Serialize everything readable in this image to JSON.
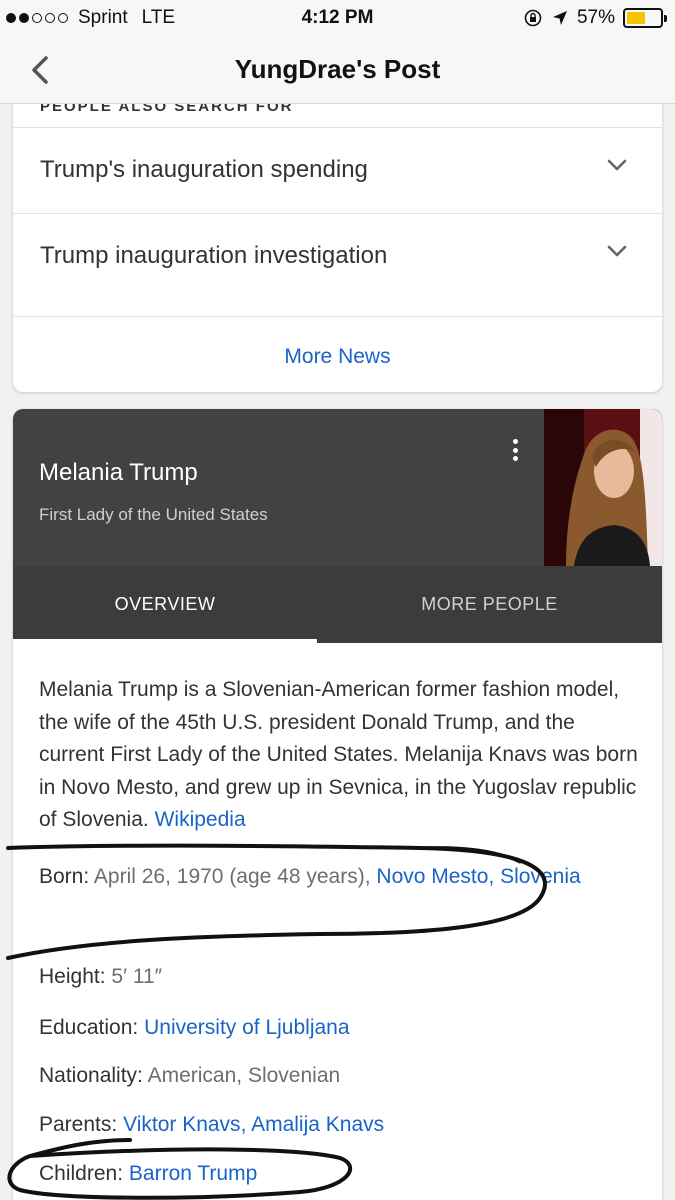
{
  "status_bar": {
    "carrier": "Sprint",
    "network": "LTE",
    "time": "4:12 PM",
    "battery_percent": "57%",
    "battery_level": 0.57,
    "signal_bars_filled": 2,
    "signal_bars_total": 5,
    "colors": {
      "battery": "#f6c400"
    }
  },
  "nav": {
    "title": "YungDrae's Post"
  },
  "people_also_search": {
    "header": "PEOPLE ALSO SEARCH FOR",
    "items": [
      {
        "label": "Trump's inauguration spending"
      },
      {
        "label": "Trump inauguration investigation"
      }
    ],
    "more_news": "More News"
  },
  "knowledge_panel": {
    "name": "Melania Trump",
    "subtitle": "First Lady of the United States",
    "tabs": [
      {
        "label": "OVERVIEW",
        "active": true
      },
      {
        "label": "MORE PEOPLE",
        "active": false
      }
    ],
    "description": "Melania Trump is a Slovenian-American former fashion model, the wife of the 45th U.S. president Donald Trump, and the current First Lady of the United States. Melanija Knavs was born in Novo Mesto, and grew up in Sevnica, in the Yugoslav republic of Slovenia.",
    "source_link": "Wikipedia",
    "facts": {
      "born": {
        "label": "Born:",
        "value": "April 26, 1970 (age 48 years),",
        "link": "Novo Mesto, Slovenia"
      },
      "height": {
        "label": "Height:",
        "value": "5′ 11″"
      },
      "education": {
        "label": "Education:",
        "link": "University of Ljubljana"
      },
      "nationality": {
        "label": "Nationality:",
        "value": "American, Slovenian"
      },
      "parents": {
        "label": "Parents:",
        "links": [
          "Viktor Knavs",
          "Amalija Knavs"
        ]
      },
      "children": {
        "label": "Children:",
        "link": "Barron Trump"
      }
    },
    "colors": {
      "header_bg": "#424242",
      "tabs_bg": "#3c3c3c",
      "link": "#1a63c9"
    }
  }
}
